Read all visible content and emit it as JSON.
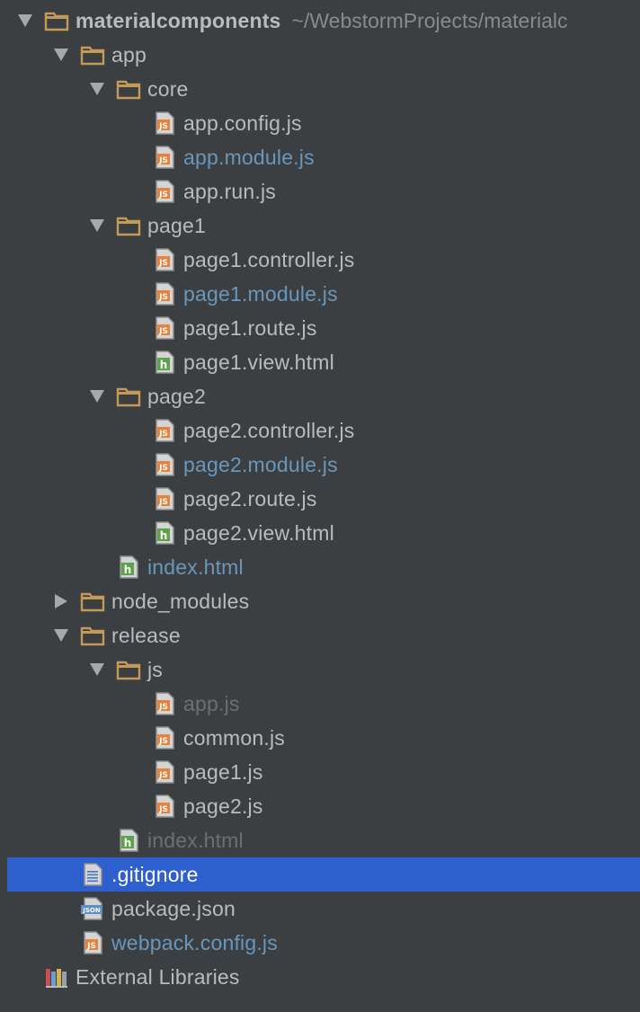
{
  "tree": [
    {
      "label": "materialcomponents",
      "suffix": "~/WebstormProjects/materialc",
      "type": "folder",
      "depth": 0,
      "arrow": "down",
      "style": "bold"
    },
    {
      "label": "app",
      "type": "folder",
      "depth": 1,
      "arrow": "down",
      "style": "normal"
    },
    {
      "label": "core",
      "type": "folder",
      "depth": 2,
      "arrow": "down",
      "style": "normal"
    },
    {
      "label": "app.config.js",
      "type": "js",
      "depth": 3,
      "style": "normal"
    },
    {
      "label": "app.module.js",
      "type": "js",
      "depth": 3,
      "style": "blue"
    },
    {
      "label": "app.run.js",
      "type": "js",
      "depth": 3,
      "style": "normal"
    },
    {
      "label": "page1",
      "type": "folder",
      "depth": 2,
      "arrow": "down",
      "style": "normal"
    },
    {
      "label": "page1.controller.js",
      "type": "js",
      "depth": 3,
      "style": "normal"
    },
    {
      "label": "page1.module.js",
      "type": "js",
      "depth": 3,
      "style": "blue"
    },
    {
      "label": "page1.route.js",
      "type": "js",
      "depth": 3,
      "style": "normal"
    },
    {
      "label": "page1.view.html",
      "type": "html",
      "depth": 3,
      "style": "normal"
    },
    {
      "label": "page2",
      "type": "folder",
      "depth": 2,
      "arrow": "down",
      "style": "normal"
    },
    {
      "label": "page2.controller.js",
      "type": "js",
      "depth": 3,
      "style": "normal"
    },
    {
      "label": "page2.module.js",
      "type": "js",
      "depth": 3,
      "style": "blue"
    },
    {
      "label": "page2.route.js",
      "type": "js",
      "depth": 3,
      "style": "normal"
    },
    {
      "label": "page2.view.html",
      "type": "html",
      "depth": 3,
      "style": "normal"
    },
    {
      "label": "index.html",
      "type": "html",
      "depth": 2,
      "style": "blue"
    },
    {
      "label": "node_modules",
      "type": "folder",
      "depth": 1,
      "arrow": "right",
      "style": "normal"
    },
    {
      "label": "release",
      "type": "folder",
      "depth": 1,
      "arrow": "down",
      "style": "normal"
    },
    {
      "label": "js",
      "type": "folder",
      "depth": 2,
      "arrow": "down",
      "style": "normal"
    },
    {
      "label": "app.js",
      "type": "js",
      "depth": 3,
      "style": "gray"
    },
    {
      "label": "common.js",
      "type": "js",
      "depth": 3,
      "style": "normal"
    },
    {
      "label": "page1.js",
      "type": "js",
      "depth": 3,
      "style": "normal"
    },
    {
      "label": "page2.js",
      "type": "js",
      "depth": 3,
      "style": "normal"
    },
    {
      "label": "index.html",
      "type": "html",
      "depth": 2,
      "style": "gray"
    },
    {
      "label": ".gitignore",
      "type": "text",
      "depth": 1,
      "style": "white",
      "selected": true
    },
    {
      "label": "package.json",
      "type": "json",
      "depth": 1,
      "style": "normal"
    },
    {
      "label": "webpack.config.js",
      "type": "js",
      "depth": 1,
      "style": "blue"
    },
    {
      "label": "External Libraries",
      "type": "library",
      "depth": 0,
      "style": "normal"
    }
  ],
  "icons": {
    "folder": "folder-icon",
    "js": "js-file-icon",
    "html": "html-file-icon",
    "text": "text-file-icon",
    "json": "json-file-icon",
    "library": "library-icon"
  },
  "icon_text": {
    "js": "JS",
    "html": "h",
    "json": "JSON"
  },
  "colors": {
    "background": "#3c3f41",
    "selection": "#2d5fcf",
    "text": "#bbbbbb",
    "modified": "#6897bb",
    "ignored": "#6e6e6e",
    "folder": "#c49a58"
  }
}
